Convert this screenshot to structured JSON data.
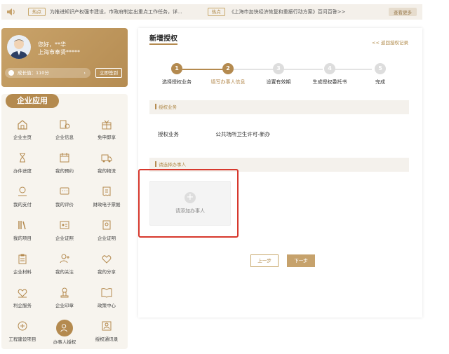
{
  "notice": {
    "tag1": "热点",
    "text1": "为推进知识产权强市建设，市政府制定出重点工作任务，详...",
    "tag2": "热点",
    "text2": "《上海市加快经济恢复和重振行动方案》百问百答>>",
    "more": "查看更多"
  },
  "user": {
    "greeting": "您好，**华",
    "region": "上海市奉贤*****",
    "growth": "成长值：110分",
    "signin": "立即签到"
  },
  "apps": {
    "title": "企业应用",
    "items": [
      {
        "label": "企业主页",
        "icon": "home-icon"
      },
      {
        "label": "企业信息",
        "icon": "company-info-icon"
      },
      {
        "label": "免申即享",
        "icon": "gift-icon"
      },
      {
        "label": "办件进度",
        "icon": "hourglass-icon"
      },
      {
        "label": "我的预约",
        "icon": "calendar-icon"
      },
      {
        "label": "我的物流",
        "icon": "truck-icon"
      },
      {
        "label": "我的支付",
        "icon": "payment-icon"
      },
      {
        "label": "我的评价",
        "icon": "comment-icon"
      },
      {
        "label": "财政电子票据",
        "icon": "receipt-icon"
      },
      {
        "label": "我的项目",
        "icon": "books-icon"
      },
      {
        "label": "企业证照",
        "icon": "license-icon"
      },
      {
        "label": "企业证明",
        "icon": "certificate-icon"
      },
      {
        "label": "企业材料",
        "icon": "clipboard-icon"
      },
      {
        "label": "我的关注",
        "icon": "follow-icon"
      },
      {
        "label": "我的分享",
        "icon": "heart-icon"
      },
      {
        "label": "利企服务",
        "icon": "service-icon"
      },
      {
        "label": "企业印章",
        "icon": "seal-icon"
      },
      {
        "label": "政策中心",
        "icon": "policy-icon"
      },
      {
        "label": "工程建设项目",
        "icon": "building-icon"
      },
      {
        "label": "办事人授权",
        "icon": "authorize-icon"
      },
      {
        "label": "授权通讯录",
        "icon": "contacts-icon"
      }
    ]
  },
  "main": {
    "title": "新增授权",
    "back": "<< 返回授权记录",
    "steps": [
      {
        "num": "1",
        "label": "选择授权业务"
      },
      {
        "num": "2",
        "label": "填写办事人信息"
      },
      {
        "num": "3",
        "label": "设置有效期"
      },
      {
        "num": "4",
        "label": "生成授权委托书"
      },
      {
        "num": "5",
        "label": "完成"
      }
    ],
    "section1": "授权业务",
    "auth_label": "授权业务",
    "auth_value": "公共场所卫生许可-新办",
    "section2": "请选择办事人",
    "add_text": "请添加办事人",
    "prev": "上一步",
    "next": "下一步"
  },
  "colors": {
    "accent": "#b48a4f",
    "highlight": "#d7382d"
  }
}
